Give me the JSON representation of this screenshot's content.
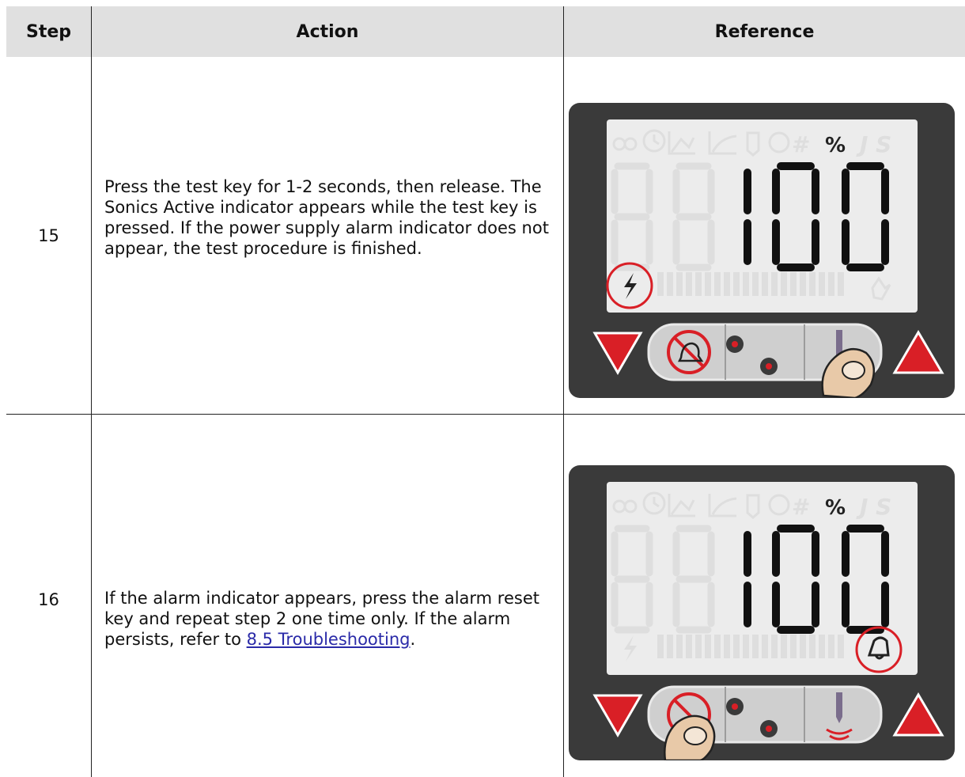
{
  "table": {
    "headers": {
      "step": "Step",
      "action": "Action",
      "reference": "Reference"
    },
    "rows": [
      {
        "step": "15",
        "action_text": "Press the test key for 1-2 seconds, then release. The Sonics Active indicator appears while the test key is pressed. If the power supply alarm indicator does not appear, the test procedure is finished.",
        "display": {
          "percent_symbol": "%",
          "ghost_letters": "J S",
          "readout": "100",
          "highlighted_indicator": "sonics-active (lightning)",
          "pressed_key": "test key"
        }
      },
      {
        "step": "16",
        "action_text_before": "If the alarm indicator appears, press the alarm reset key and repeat step 2 one time only. If the alarm persists, refer to ",
        "link_text": "8.5 Troubleshooting",
        "action_text_after": ".",
        "display": {
          "percent_symbol": "%",
          "ghost_letters": "J S",
          "readout": "100",
          "highlighted_indicator": "alarm (bell)",
          "pressed_key": "alarm reset key"
        }
      }
    ]
  },
  "colors": {
    "header_bg": "#e0e0e0",
    "panel": "#3a3a3a",
    "lcd": "#ececec",
    "highlight": "#d91f26",
    "link": "#2a2aa8"
  }
}
